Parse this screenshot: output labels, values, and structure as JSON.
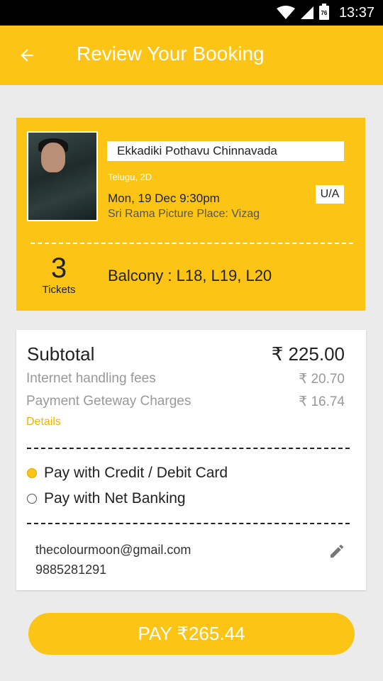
{
  "status_bar": {
    "time": "13:37",
    "battery": "76"
  },
  "header": {
    "title": "Review Your Booking"
  },
  "booking": {
    "movie_title": "Ekkadiki Pothavu Chinnavada",
    "language_format": "Telugu, 2D",
    "certificate": "U/A",
    "show_time": "Mon, 19 Dec 9:30pm",
    "theatre": "Sri Rama Picture Place: Vizag",
    "ticket_count": "3",
    "tickets_label": "Tickets",
    "seats": "Balcony : L18, L19, L20"
  },
  "summary": {
    "subtotal_label": "Subtotal",
    "subtotal_value": "₹ 225.00",
    "internet_fee_label": "Internet handling fees",
    "internet_fee_value": "₹ 20.70",
    "gateway_fee_label": "Payment Geteway Charges",
    "gateway_fee_value": "₹ 16.74",
    "details_link": "Details"
  },
  "payment_options": [
    {
      "label": "Pay with Credit / Debit Card",
      "selected": true
    },
    {
      "label": "Pay with Net Banking",
      "selected": false
    }
  ],
  "contact": {
    "email": "thecolourmoon@gmail.com",
    "phone": "9885281291"
  },
  "pay_button": {
    "label": "PAY ₹265.44"
  },
  "colors": {
    "accent": "#fcc414",
    "background": "#ebebeb",
    "status_bar": "#000000"
  }
}
